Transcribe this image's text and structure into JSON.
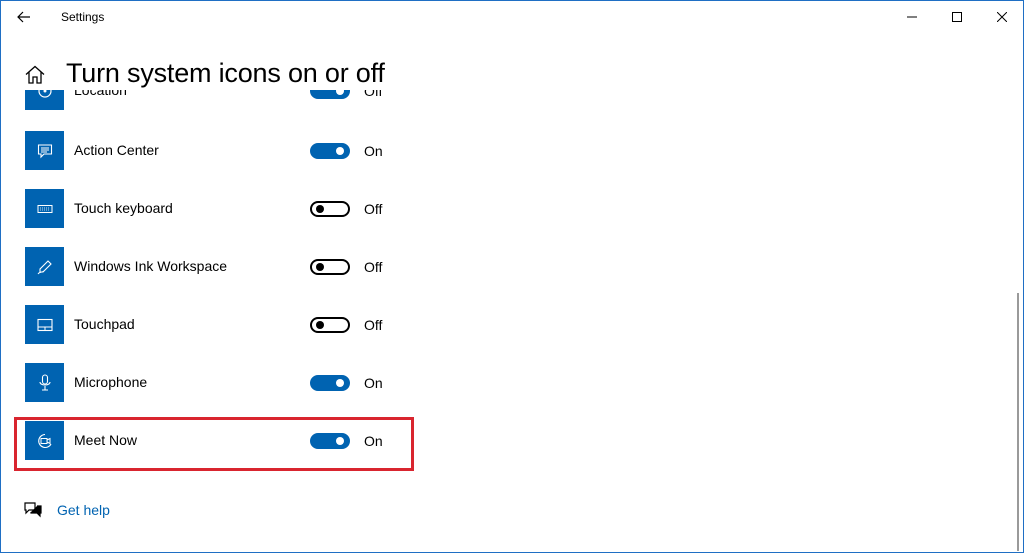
{
  "window": {
    "title": "Settings",
    "back_icon": "back-arrow-icon",
    "controls": [
      "minimize-icon",
      "maximize-icon",
      "close-icon"
    ]
  },
  "header": {
    "home_icon": "home-icon",
    "title": "Turn system icons on or off"
  },
  "items": [
    {
      "label": "Location",
      "icon": "location-icon",
      "state": "Off",
      "on": false
    },
    {
      "label": "Action Center",
      "icon": "action-center-icon",
      "state": "On",
      "on": true
    },
    {
      "label": "Touch keyboard",
      "icon": "keyboard-icon",
      "state": "Off",
      "on": false
    },
    {
      "label": "Windows Ink Workspace",
      "icon": "pen-icon",
      "state": "Off",
      "on": false
    },
    {
      "label": "Touchpad",
      "icon": "touchpad-icon",
      "state": "Off",
      "on": false
    },
    {
      "label": "Microphone",
      "icon": "microphone-icon",
      "state": "On",
      "on": true
    },
    {
      "label": "Meet Now",
      "icon": "meet-now-icon",
      "state": "On",
      "on": true
    }
  ],
  "footer": {
    "help_icon": "help-chat-icon",
    "help_label": "Get help"
  },
  "colors": {
    "accent": "#0063b1",
    "highlight": "#d9252f",
    "window_border": "#1f6fc4"
  }
}
